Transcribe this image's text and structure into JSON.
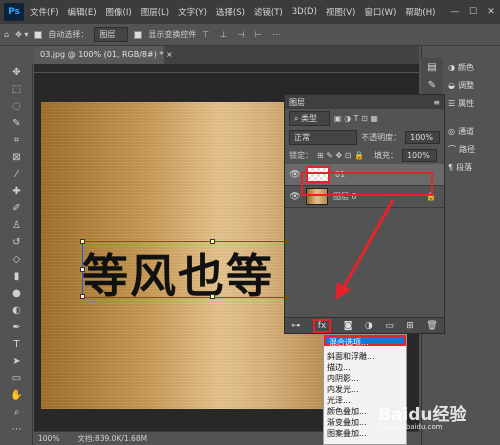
{
  "menubar": {
    "logo": "Ps",
    "items": [
      "文件(F)",
      "编辑(E)",
      "图像(I)",
      "图层(L)",
      "文字(Y)",
      "选择(S)",
      "滤镜(T)",
      "3D(D)",
      "视图(V)",
      "窗口(W)",
      "帮助(H)"
    ],
    "controls": [
      "—",
      "☐",
      "✕"
    ]
  },
  "options": {
    "auto_select_label": "自动选择：",
    "auto_select_value": "图层",
    "show_transform_label": "显示变换控件"
  },
  "document": {
    "tab_title": "03.jpg @ 100% (01, RGB/8#) *",
    "text": "等风也等"
  },
  "status": {
    "zoom": "100%",
    "doc_size": "文档:839.0K/1.68M"
  },
  "layers_panel": {
    "title": "图层",
    "filter_kind": "类型",
    "blend_mode": "正常",
    "opacity_label": "不透明度：",
    "opacity_value": "100%",
    "lock_label": "锁定：",
    "fill_label": "填充：",
    "fill_value": "100%",
    "layers": [
      {
        "name": "01",
        "selected": true
      },
      {
        "name": "图层 0",
        "selected": false
      }
    ],
    "fx_label": "fx"
  },
  "fx_menu": {
    "items": [
      "混合选项...",
      "斜面和浮雕...",
      "描边...",
      "内阴影...",
      "内发光...",
      "光泽...",
      "颜色叠加...",
      "渐变叠加...",
      "图案叠加..."
    ]
  },
  "right_panel": {
    "items": [
      "颜色",
      "调整",
      "属性",
      "通道",
      "路径",
      "段落"
    ]
  },
  "watermark": {
    "text": "Baidu经验",
    "sub": "jingyan.baidu.com"
  },
  "colors": {
    "highlight": "#1976d2",
    "callout": "#e8222a"
  }
}
